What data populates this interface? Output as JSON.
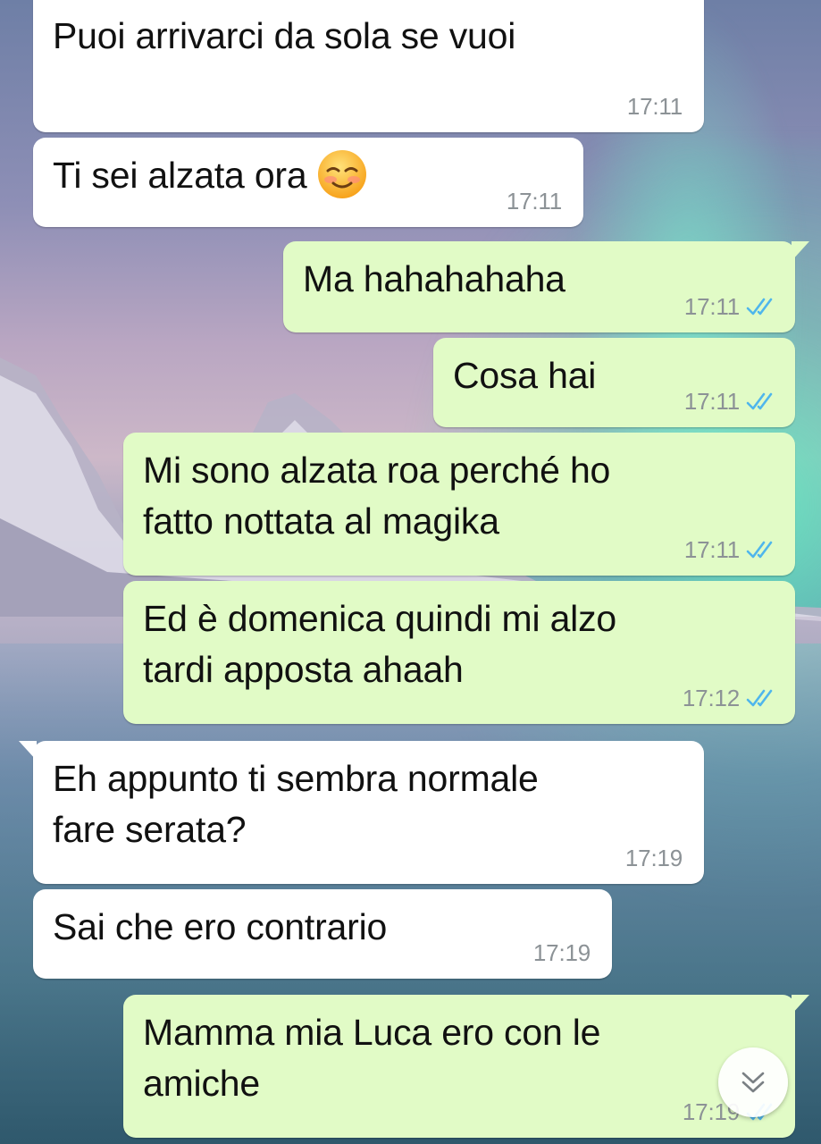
{
  "colors": {
    "incoming_bubble": "#ffffff",
    "outgoing_bubble": "#e1fbc6",
    "timestamp": "#8c9296",
    "read_ticks": "#4fb6ec"
  },
  "messages": [
    {
      "direction": "incoming",
      "text": "Puoi arrivarci da sola se vuoi",
      "time": "17:11"
    },
    {
      "direction": "incoming",
      "text": "Ti sei alzata ora",
      "emoji": "smiling-face-with-blush-icon",
      "time": "17:11"
    },
    {
      "direction": "outgoing",
      "text": "Ma hahahahaha",
      "time": "17:11",
      "status": "read"
    },
    {
      "direction": "outgoing",
      "text": "Cosa hai",
      "time": "17:11",
      "status": "read"
    },
    {
      "direction": "outgoing",
      "lines": [
        "Mi sono alzata roa perché ho",
        "fatto nottata al magika"
      ],
      "time": "17:11",
      "status": "read"
    },
    {
      "direction": "outgoing",
      "lines": [
        "Ed è domenica quindi mi alzo",
        "tardi apposta ahaah"
      ],
      "time": "17:12",
      "status": "read"
    },
    {
      "direction": "incoming",
      "lines": [
        "Eh appunto ti sembra normale",
        "fare serata?"
      ],
      "time": "17:19"
    },
    {
      "direction": "incoming",
      "text": "Sai che ero contrario",
      "time": "17:19"
    },
    {
      "direction": "outgoing",
      "lines": [
        "Mamma mia Luca ero con le",
        "amiche"
      ],
      "time": "17:19",
      "status": "read"
    }
  ],
  "scroll_button": {
    "icon": "double-chevron-down-icon"
  }
}
